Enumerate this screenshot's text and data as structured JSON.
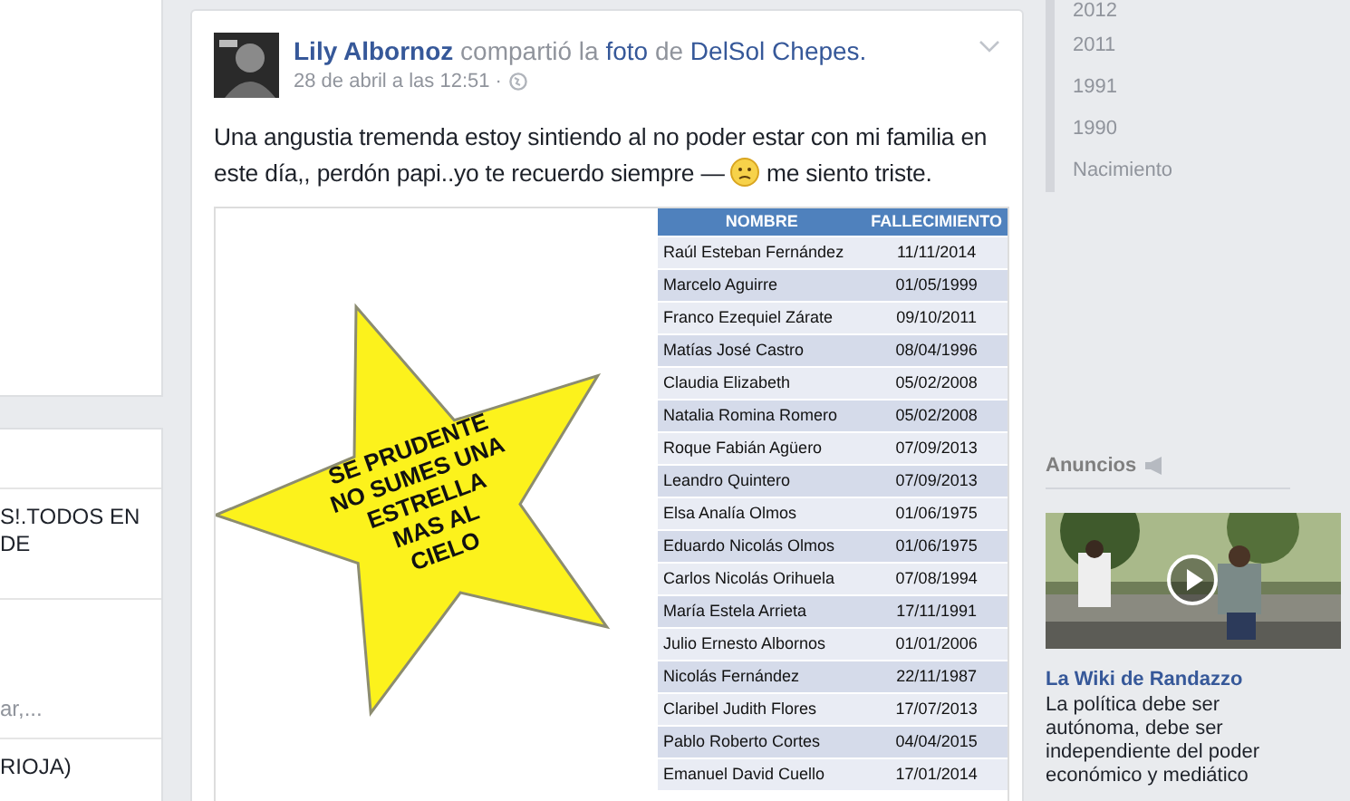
{
  "left_panel": {
    "items": [
      {
        "text": "S!.TODOS EN DE"
      },
      {
        "text": "ar,..."
      },
      {
        "text": "RIOJA)"
      }
    ]
  },
  "post": {
    "author": "Lily Albornoz",
    "verb": "compartió la",
    "photo_link": "foto",
    "preposition": "de",
    "page": "DelSol Chepes.",
    "date": "28 de abril a las 12:51 ·",
    "text": "Una angustia tremenda estoy sintiendo al no poder estar con mi familia en este día,, perdón papi..yo te recuerdo siempre —",
    "feeling": "me siento triste.",
    "image": {
      "slogan": [
        "SE PRUDENTE",
        "NO SUMES UNA",
        "ESTRELLA",
        "MAS AL",
        "CIELO"
      ],
      "columns": [
        "NOMBRE",
        "FALLECIMIENTO"
      ],
      "rows": [
        [
          "Raúl Esteban Fernández",
          "11/11/2014"
        ],
        [
          "Marcelo Aguirre",
          "01/05/1999"
        ],
        [
          "Franco Ezequiel Zárate",
          "09/10/2011"
        ],
        [
          "Matías José Castro",
          "08/04/1996"
        ],
        [
          "Claudia Elizabeth",
          "05/02/2008"
        ],
        [
          "Natalia Romina Romero",
          "05/02/2008"
        ],
        [
          "Roque Fabián Agüero",
          "07/09/2013"
        ],
        [
          "Leandro Quintero",
          "07/09/2013"
        ],
        [
          "Elsa Analía Olmos",
          "01/06/1975"
        ],
        [
          "Eduardo Nicolás Olmos",
          "01/06/1975"
        ],
        [
          "Carlos Nicolás Orihuela",
          "07/08/1994"
        ],
        [
          "María Estela Arrieta",
          "17/11/1991"
        ],
        [
          "Julio Ernesto Albornos",
          "01/01/2006"
        ],
        [
          "Nicolás Fernández",
          "22/11/1987"
        ],
        [
          "Claribel Judith Flores",
          "17/07/2013"
        ],
        [
          "Pablo Roberto Cortes",
          "04/04/2015"
        ],
        [
          "Emanuel David Cuello",
          "17/01/2014"
        ]
      ]
    }
  },
  "timeline": [
    "2012",
    "2011",
    "1991",
    "1990",
    "Nacimiento"
  ],
  "ads": {
    "heading": "Anuncios",
    "title": "La Wiki de Randazzo",
    "description": "La política debe ser autónoma, debe ser independiente del poder económico y mediático"
  }
}
